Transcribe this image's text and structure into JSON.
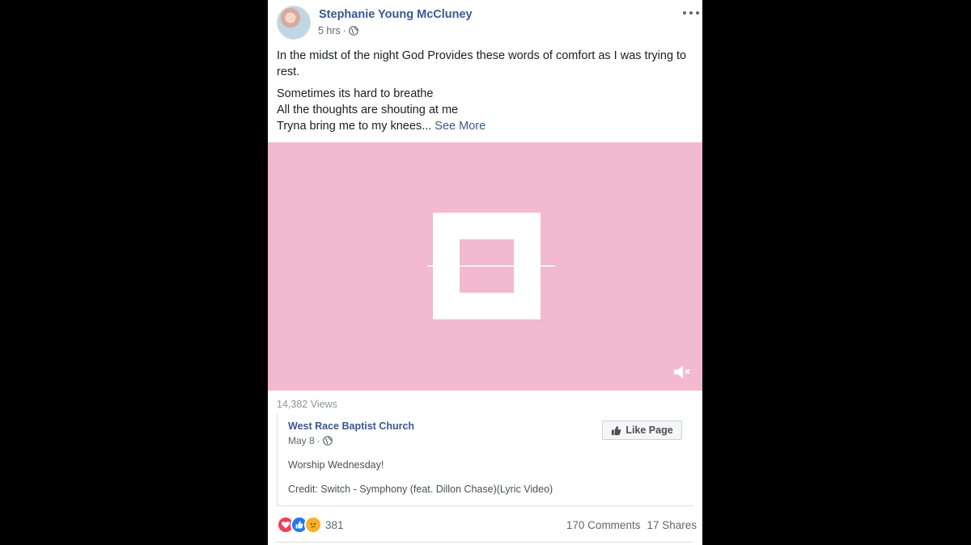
{
  "post": {
    "author": "Stephanie Young McCluney",
    "time": "5 hrs",
    "privacy_icon": "globe-icon",
    "paragraph1": "In the midst of the night God Provides these words of comfort as I was trying to rest.",
    "line1": "Sometimes its hard to breathe",
    "line2": "All the thoughts are shouting at me",
    "line3": "Tryna bring me to my knees...",
    "see_more": "See More"
  },
  "video": {
    "views": "14,382 Views",
    "background": "#f2b9cf",
    "mute_icon": "speaker-muted-icon"
  },
  "shared": {
    "page_name": "West Race Baptist Church",
    "date": "May 8",
    "like_page_label": "Like Page",
    "text1": "Worship Wednesday!",
    "text2": "Credit: Switch - Symphony (feat. Dillon Chase)(Lyric Video)"
  },
  "footer": {
    "reaction_icons": [
      "love-icon",
      "like-icon",
      "sad-icon"
    ],
    "reaction_count": "381",
    "comments": "170 Comments",
    "shares": "17 Shares"
  },
  "colors": {
    "link": "#385898",
    "secondary_text": "#606770",
    "love": "#f33e58",
    "like": "#2078f4",
    "sad": "#f7b125"
  }
}
